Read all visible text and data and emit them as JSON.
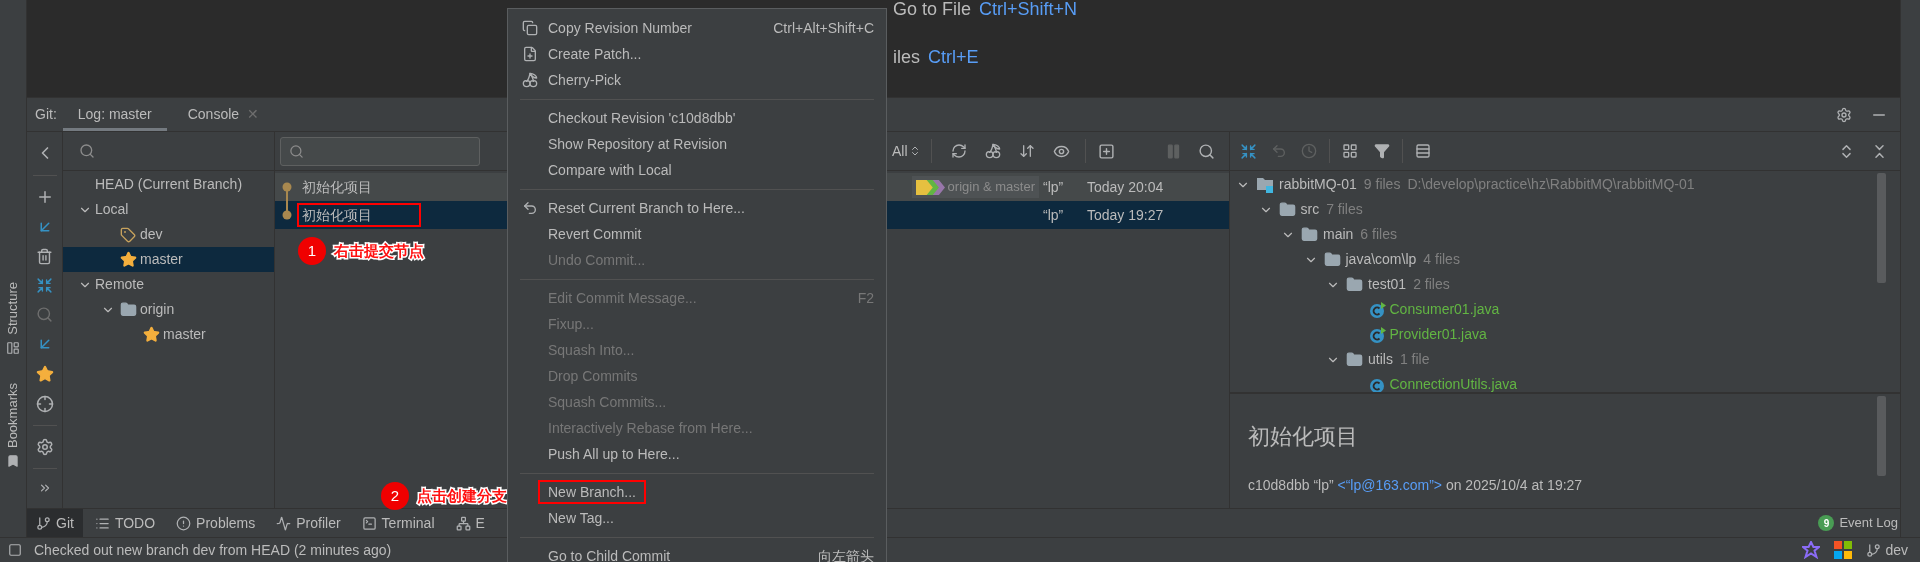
{
  "editor_hints": [
    {
      "label": "Go to File",
      "shortcut": "Ctrl+Shift+N"
    },
    {
      "label": "iles",
      "shortcut": "Ctrl+E"
    }
  ],
  "side_stripe": [
    "Structure",
    "Bookmarks"
  ],
  "tool_window": {
    "title": "Git:",
    "tabs": [
      {
        "label": "Log: master",
        "selected": true
      },
      {
        "label": "Console",
        "selected": false,
        "close": "✕"
      }
    ]
  },
  "branches": [
    {
      "label": "HEAD (Current Branch)",
      "selected": false
    },
    {
      "label": "Local",
      "selected": false,
      "expanded": true,
      "children": [
        {
          "label": "dev",
          "kind": "tag",
          "selected": false
        },
        {
          "label": "master",
          "kind": "star",
          "selected": true
        }
      ]
    },
    {
      "label": "Remote",
      "selected": false,
      "expanded": true,
      "children": [
        {
          "label": "origin",
          "kind": "folder",
          "selected": false,
          "expanded": true,
          "children": [
            {
              "label": "master",
              "kind": "star",
              "selected": false
            }
          ]
        }
      ]
    }
  ],
  "log": {
    "branch_filter": "All",
    "commits": [
      {
        "message": "初始化项目",
        "refs": "origin & master",
        "author": "“lp”",
        "time": "Today 20:04",
        "selected": false,
        "head": true,
        "highlighted": false
      },
      {
        "message": "初始化项目",
        "author": "“lp”",
        "time": "Today 19:27",
        "selected": true,
        "head": false,
        "highlighted": true
      }
    ]
  },
  "changes": [
    {
      "name": "rabbitMQ-01",
      "count": "9 files",
      "path": "D:\\develop\\practice\\hz\\RabbitMQ\\rabbitMQ-01",
      "kind": "module",
      "expanded": true,
      "children": [
        {
          "name": "src",
          "count": "7 files",
          "kind": "folder",
          "expanded": true,
          "children": [
            {
              "name": "main",
              "count": "6 files",
              "kind": "folder",
              "expanded": true,
              "children": [
                {
                  "name": "java\\com\\lp",
                  "count": "4 files",
                  "kind": "folder",
                  "expanded": true,
                  "children": [
                    {
                      "name": "test01",
                      "count": "2 files",
                      "kind": "folder",
                      "expanded": true,
                      "children": [
                        {
                          "name": "Consumer01.java",
                          "kind": "class",
                          "runnable": true
                        },
                        {
                          "name": "Provider01.java",
                          "kind": "class",
                          "runnable": true
                        }
                      ]
                    },
                    {
                      "name": "utils",
                      "count": "1 file",
                      "kind": "folder",
                      "expanded": true,
                      "children": [
                        {
                          "name": "ConnectionUtils.java",
                          "kind": "class",
                          "runnable": false
                        }
                      ]
                    }
                  ]
                }
              ]
            }
          ]
        }
      ]
    }
  ],
  "details": {
    "title": "初始化项目",
    "hash": "c10d8dbb",
    "author": "“lp”",
    "email": "<“lp@163.com”>",
    "date": "on 2025/10/4 at 19:27"
  },
  "bottom_tabs": [
    {
      "label": "Git",
      "kind": "branch",
      "selected": true
    },
    {
      "label": "TODO",
      "kind": "list",
      "selected": false
    },
    {
      "label": "Problems",
      "kind": "alert",
      "selected": false
    },
    {
      "label": "Profiler",
      "kind": "profiler",
      "selected": false
    },
    {
      "label": "Terminal",
      "kind": "terminal",
      "selected": false
    },
    {
      "label": "E",
      "kind": "build",
      "selected": false
    }
  ],
  "event_log": {
    "count": "9",
    "label": "Event Log"
  },
  "status_bar": {
    "message": "Checked out new branch dev from HEAD (2 minutes ago)",
    "branch": "dev"
  },
  "context_menu": [
    {
      "kind": "copy",
      "label": "Copy Revision Number",
      "shortcut": "Ctrl+Alt+Shift+C",
      "disabled": false,
      "highlighted": false
    },
    {
      "kind": "patch",
      "label": "Create Patch...",
      "disabled": false,
      "highlighted": false
    },
    {
      "kind": "cherry",
      "label": "Cherry-Pick",
      "disabled": false,
      "highlighted": false
    },
    {
      "kind": "separator"
    },
    {
      "kind": "item",
      "label": "Checkout Revision 'c10d8dbb'",
      "disabled": false,
      "highlighted": false
    },
    {
      "kind": "item",
      "label": "Show Repository at Revision",
      "disabled": false,
      "highlighted": false
    },
    {
      "kind": "item",
      "label": "Compare with Local",
      "disabled": false,
      "highlighted": false
    },
    {
      "kind": "separator"
    },
    {
      "kind": "reset",
      "label": "Reset Current Branch to Here...",
      "disabled": false,
      "highlighted": false
    },
    {
      "kind": "item",
      "label": "Revert Commit",
      "disabled": false,
      "highlighted": false
    },
    {
      "kind": "item",
      "label": "Undo Commit...",
      "disabled": true,
      "highlighted": false
    },
    {
      "kind": "separator"
    },
    {
      "kind": "item",
      "label": "Edit Commit Message...",
      "shortcut": "F2",
      "disabled": true,
      "highlighted": false
    },
    {
      "kind": "item",
      "label": "Fixup...",
      "disabled": true,
      "highlighted": false
    },
    {
      "kind": "item",
      "label": "Squash Into...",
      "disabled": true,
      "highlighted": false
    },
    {
      "kind": "item",
      "label": "Drop Commits",
      "disabled": true,
      "highlighted": false
    },
    {
      "kind": "item",
      "label": "Squash Commits...",
      "disabled": true,
      "highlighted": false
    },
    {
      "kind": "item",
      "label": "Interactively Rebase from Here...",
      "disabled": true,
      "highlighted": false
    },
    {
      "kind": "item",
      "label": "Push All up to Here...",
      "disabled": false,
      "highlighted": false
    },
    {
      "kind": "separator"
    },
    {
      "kind": "item",
      "label": "New Branch...",
      "disabled": false,
      "highlighted": true
    },
    {
      "kind": "item",
      "label": "New Tag...",
      "disabled": false,
      "highlighted": false
    },
    {
      "kind": "separator"
    },
    {
      "kind": "item",
      "label": "Go to Child Commit",
      "shortcut": "向左箭头",
      "disabled": false,
      "highlighted": false
    }
  ],
  "annotations": [
    {
      "number": "1",
      "text": "右击提交节点"
    },
    {
      "number": "2",
      "text": "点击创建分支"
    }
  ]
}
